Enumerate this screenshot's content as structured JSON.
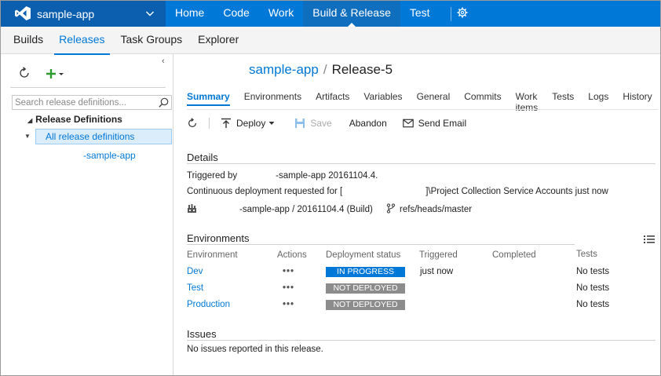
{
  "app": {
    "project_name": "sample-app",
    "colors": {
      "accent": "#0078d7",
      "project_bg": "#0b5fae",
      "in_progress": "#0078d7",
      "not_deployed": "#8c8c8c"
    }
  },
  "top_nav": [
    "Home",
    "Code",
    "Work",
    "Build & Release",
    "Test"
  ],
  "sub_nav": [
    "Builds",
    "Releases",
    "Task Groups",
    "Explorer"
  ],
  "left": {
    "search_placeholder": "Search release definitions...",
    "tree_root": "Release Definitions",
    "tree_selected": "All release definitions",
    "tree_child": "-sample-app"
  },
  "release": {
    "definition": "sample-app",
    "separator": "/",
    "name": "Release-5",
    "tabs": [
      "Summary",
      "Environments",
      "Artifacts",
      "Variables",
      "General",
      "Commits",
      "Work items",
      "Tests",
      "Logs",
      "History"
    ],
    "toolbar": {
      "deploy": "Deploy",
      "save": "Save",
      "abandon": "Abandon",
      "send_email": "Send Email"
    }
  },
  "details": {
    "heading": "Details",
    "triggered_label": "Triggered by",
    "triggered_value": "-sample-app 20161104.4.",
    "cd_label": "Continuous deployment requested for [",
    "cd_value": "]\\Project Collection Service Accounts just now",
    "artifact": "-sample-app / 20161104.4 (Build)",
    "branch": "refs/heads/master"
  },
  "environments": {
    "heading": "Environments",
    "columns": [
      "Environment",
      "Actions",
      "Deployment status",
      "Triggered",
      "Completed",
      "Tests"
    ],
    "rows": [
      {
        "name": "Dev",
        "actions": "•••",
        "status": "IN PROGRESS",
        "status_kind": "in-progress",
        "triggered": "just now",
        "completed": "",
        "tests": "No tests"
      },
      {
        "name": "Test",
        "actions": "•••",
        "status": "NOT DEPLOYED",
        "status_kind": "not-deployed",
        "triggered": "",
        "completed": "",
        "tests": "No tests"
      },
      {
        "name": "Production",
        "actions": "•••",
        "status": "NOT DEPLOYED",
        "status_kind": "not-deployed",
        "triggered": "",
        "completed": "",
        "tests": "No tests"
      }
    ]
  },
  "issues": {
    "heading": "Issues",
    "text": "No issues reported in this release."
  }
}
